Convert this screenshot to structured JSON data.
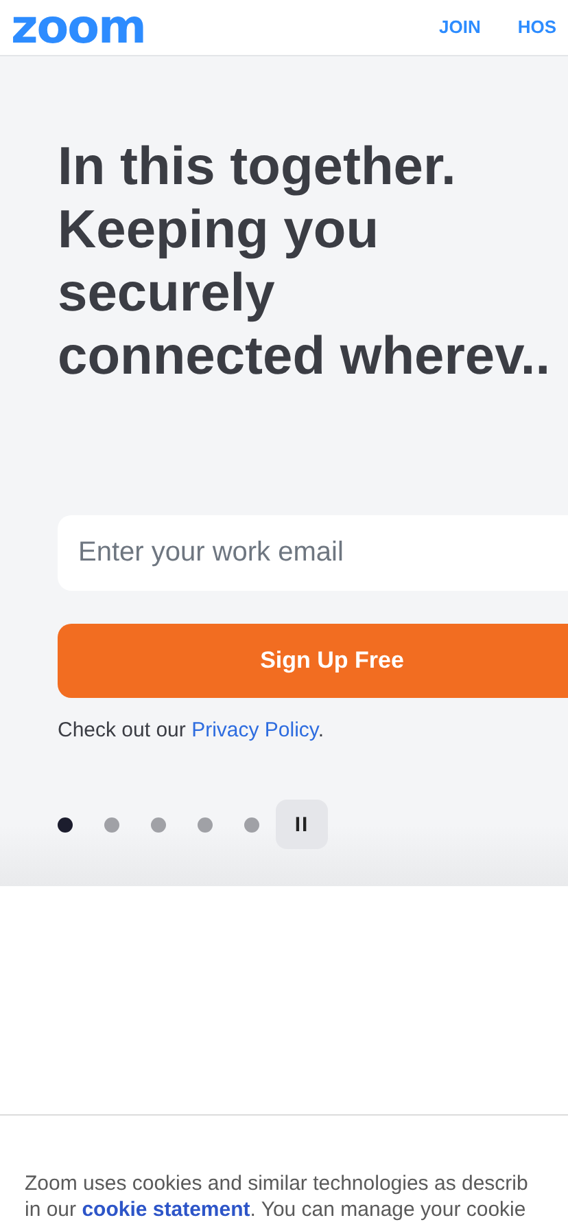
{
  "header": {
    "logo": "zoom",
    "nav": [
      {
        "label": "JOIN"
      },
      {
        "label": "HOS"
      }
    ]
  },
  "hero": {
    "headline": [
      "In this together.",
      "Keeping you",
      "securely",
      "connected wherev.."
    ],
    "email": {
      "placeholder": "Enter your work email"
    },
    "signup_button": "Sign Up Free",
    "privacy": {
      "before": "Check out our ",
      "link": "Privacy Policy",
      "after": "."
    },
    "carousel_dots": [
      {
        "selected": true
      },
      {
        "selected": false
      },
      {
        "selected": false
      },
      {
        "selected": false
      },
      {
        "selected": false
      }
    ],
    "pause_button": "II"
  },
  "cookie_banner": {
    "line_1": "Zoom uses cookies and similar technologies as describ",
    "line_2_before": "in our ",
    "line_2_link": "cookie statement",
    "line_2_after": ". You can manage your cookie"
  }
}
